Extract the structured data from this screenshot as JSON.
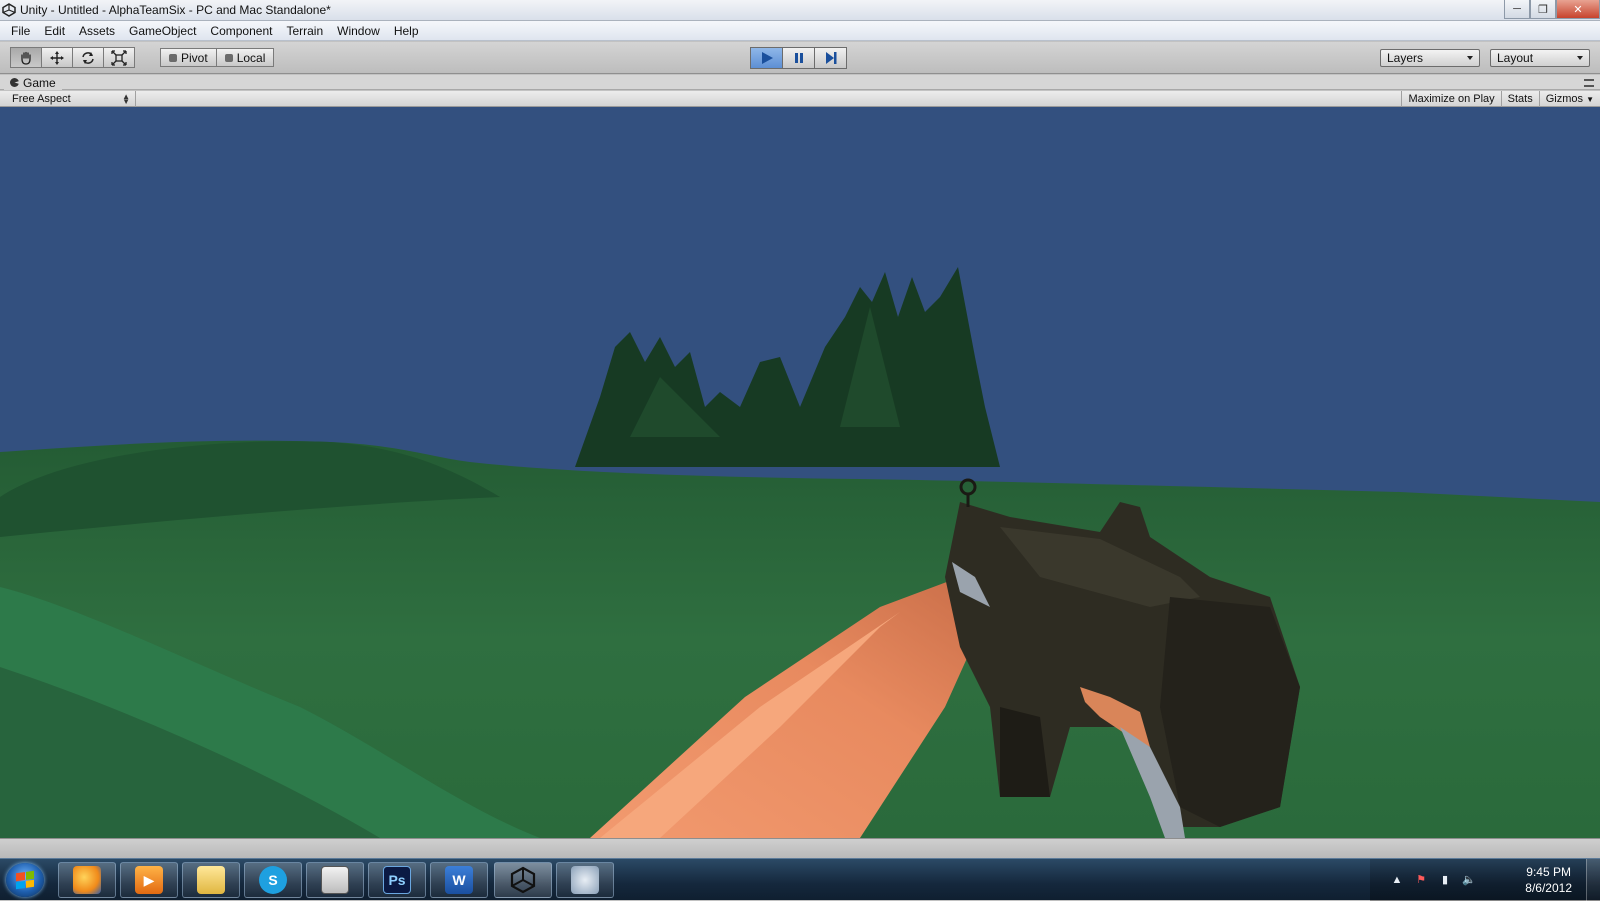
{
  "window": {
    "title": "Unity - Untitled - AlphaTeamSix - PC and Mac Standalone*",
    "minimize_icon": "minimize-icon",
    "maximize_icon": "restore-icon",
    "close_icon": "close-icon"
  },
  "menu": {
    "items": [
      "File",
      "Edit",
      "Assets",
      "GameObject",
      "Component",
      "Terrain",
      "Window",
      "Help"
    ]
  },
  "toolbar": {
    "transform_tools": [
      {
        "name": "hand-tool-icon"
      },
      {
        "name": "move-tool-icon"
      },
      {
        "name": "rotate-tool-icon"
      },
      {
        "name": "scale-tool-icon"
      }
    ],
    "pivot_label": "Pivot",
    "local_label": "Local",
    "play_icon": "play-icon",
    "pause_icon": "pause-icon",
    "step_icon": "step-icon",
    "layers_label": "Layers",
    "layout_label": "Layout"
  },
  "game_panel": {
    "tab_label": "Game",
    "aspect_label": "Free Aspect",
    "maximize_on_play_label": "Maximize on Play",
    "stats_label": "Stats",
    "gizmos_label": "Gizmos"
  },
  "taskbar": {
    "apps": [
      {
        "name": "firefox-icon",
        "label": ""
      },
      {
        "name": "media-player-icon",
        "label": ""
      },
      {
        "name": "file-explorer-icon",
        "label": ""
      },
      {
        "name": "skype-icon",
        "label": "S"
      },
      {
        "name": "window-app-icon",
        "label": ""
      },
      {
        "name": "photoshop-icon",
        "label": "Ps"
      },
      {
        "name": "word-icon",
        "label": "W"
      },
      {
        "name": "unity-icon",
        "label": ""
      },
      {
        "name": "network-app-icon",
        "label": ""
      }
    ],
    "clock_time": "9:45 PM",
    "clock_date": "8/6/2012"
  },
  "colors": {
    "sky": "#33507f",
    "terrain": "#2c6a3c",
    "mountains": "#183a24",
    "gun": "#2d2a20",
    "arm": "#e58860"
  }
}
